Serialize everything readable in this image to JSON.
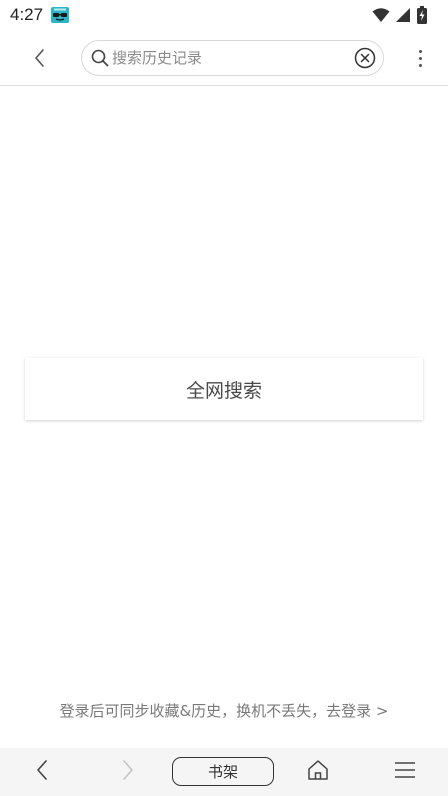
{
  "status_bar": {
    "time": "4:27",
    "app_icon": "emoji-app-icon",
    "wifi_icon": "wifi-icon",
    "signal_icon": "cell-signal-icon",
    "battery_icon": "battery-icon"
  },
  "header": {
    "back_icon": "chevron-left-icon",
    "search": {
      "placeholder": "搜索历史记录",
      "value": ""
    },
    "clear_icon": "clear-circle-icon",
    "more_icon": "more-vertical-icon"
  },
  "main": {
    "search_all_label": "全网搜索",
    "login_prompt": "登录后可同步收藏&历史，换机不丢失，去登录 >"
  },
  "bottom_bar": {
    "back_icon": "chevron-left-icon",
    "forward_icon": "chevron-right-icon",
    "shelf_label": "书架",
    "home_icon": "home-icon",
    "menu_icon": "menu-icon"
  },
  "colors": {
    "status_app_icon": "#2bb5c7",
    "toolbar_bg": "#f5f5f5",
    "divider": "#e2e2e2"
  }
}
